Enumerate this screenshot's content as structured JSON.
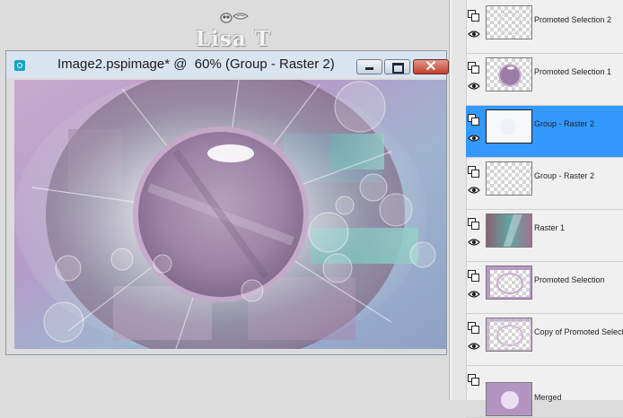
{
  "watermark": {
    "text": "Lisa T"
  },
  "window": {
    "title": "Image2.pspimage* @  60% (Group - Raster 2)",
    "close_label": "✕"
  },
  "layers": [
    {
      "name": "Promoted Selection 2",
      "thumb": "sparse"
    },
    {
      "name": "Promoted Selection 1",
      "thumb": "orb"
    },
    {
      "name": "Group - Raster 2",
      "thumb": "white",
      "selected": true
    },
    {
      "name": "Group - Raster 2",
      "thumb": "checker"
    },
    {
      "name": "Raster 1",
      "thumb": "gradient"
    },
    {
      "name": "Promoted Selection",
      "thumb": "frame"
    },
    {
      "name": "Copy of Promoted Selection",
      "thumb": "frame"
    },
    {
      "name": "Merged",
      "thumb": "merged"
    }
  ],
  "colors": {
    "selection": "#3399ff",
    "teal": "#6fb6b0",
    "mauve": "#9a7d9c",
    "lavender": "#c8b7da"
  }
}
